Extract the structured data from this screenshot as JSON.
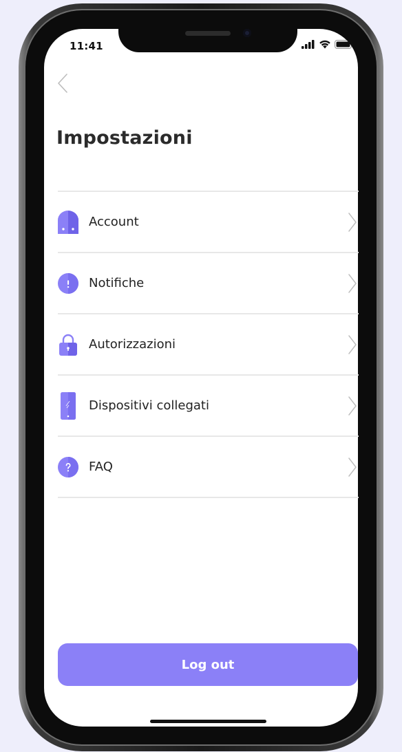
{
  "status_bar": {
    "time": "11:41",
    "icons": [
      "signal-icon",
      "wifi-icon",
      "battery-icon"
    ]
  },
  "header": {
    "back_icon": "chevron-left-icon",
    "title": "Impostazioni"
  },
  "settings": {
    "items": [
      {
        "label": "Account",
        "icon": "account-icon"
      },
      {
        "label": "Notifiche",
        "icon": "notification-icon"
      },
      {
        "label": "Autorizzazioni",
        "icon": "lock-icon"
      },
      {
        "label": "Dispositivi collegati",
        "icon": "device-icon"
      },
      {
        "label": "FAQ",
        "icon": "help-icon"
      }
    ]
  },
  "logout": {
    "label": "Log out"
  },
  "colors": {
    "accent": "#8B80F7",
    "accent_dark": "#6F63E8",
    "background": "#EEEEFB",
    "divider": "#E7E7E7",
    "text": "#2B2B2B"
  }
}
